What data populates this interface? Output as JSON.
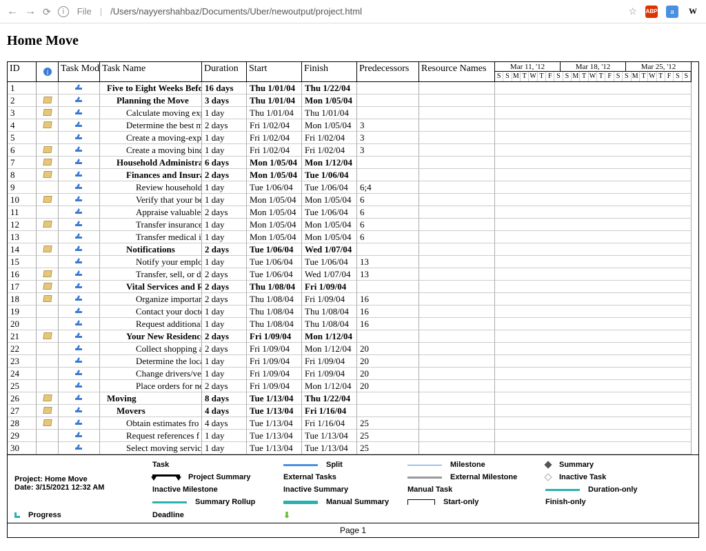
{
  "browser": {
    "url_prefix": "File",
    "url_path": "/Users/nayyershahbaz/Documents/Uber/newoutput/project.html"
  },
  "title": "Home Move",
  "columns": {
    "id": "ID",
    "info": "ℹ",
    "task_mode": "Task Mode",
    "task_name": "Task Name",
    "duration": "Duration",
    "start": "Start",
    "finish": "Finish",
    "predecessors": "Predecessors",
    "resource_names": "Resource Names"
  },
  "gantt": {
    "months": [
      "Mar 11, '12",
      "Mar 18, '12",
      "Mar 25, '12"
    ],
    "days": [
      "S",
      "S",
      "M",
      "T",
      "W",
      "T",
      "F",
      "S",
      "S",
      "M",
      "T",
      "W",
      "T",
      "F",
      "S",
      "S",
      "M",
      "T",
      "W",
      "T",
      "F",
      "S",
      "S"
    ]
  },
  "rows": [
    {
      "id": "1",
      "note": false,
      "indent": 0,
      "bold": true,
      "name": "Five to Eight Weeks Befo",
      "duration": "16 days",
      "start": "Thu 1/01/04",
      "finish": "Thu 1/22/04",
      "pred": "",
      "res": ""
    },
    {
      "id": "2",
      "note": true,
      "indent": 1,
      "bold": true,
      "name": "Planning the Move",
      "duration": "3 days",
      "start": "Thu 1/01/04",
      "finish": "Mon 1/05/04",
      "pred": "",
      "res": ""
    },
    {
      "id": "3",
      "note": true,
      "indent": 2,
      "bold": false,
      "name": "Calculate moving exp",
      "duration": "1 day",
      "start": "Thu 1/01/04",
      "finish": "Thu 1/01/04",
      "pred": "",
      "res": ""
    },
    {
      "id": "4",
      "note": true,
      "indent": 2,
      "bold": false,
      "name": "Determine the best m",
      "duration": "2 days",
      "start": "Fri 1/02/04",
      "finish": "Mon 1/05/04",
      "pred": "3",
      "res": ""
    },
    {
      "id": "5",
      "note": false,
      "indent": 2,
      "bold": false,
      "name": "Create a moving-expe",
      "duration": "1 day",
      "start": "Fri 1/02/04",
      "finish": "Fri 1/02/04",
      "pred": "3",
      "res": ""
    },
    {
      "id": "6",
      "note": true,
      "indent": 2,
      "bold": false,
      "name": "Create a moving bind",
      "duration": "1 day",
      "start": "Fri 1/02/04",
      "finish": "Fri 1/02/04",
      "pred": "3",
      "res": ""
    },
    {
      "id": "7",
      "note": true,
      "indent": 1,
      "bold": true,
      "name": "Household Administratio",
      "duration": "6 days",
      "start": "Mon 1/05/04",
      "finish": "Mon 1/12/04",
      "pred": "",
      "res": ""
    },
    {
      "id": "8",
      "note": true,
      "indent": 2,
      "bold": true,
      "name": "Finances and Insuran",
      "duration": "2 days",
      "start": "Mon 1/05/04",
      "finish": "Tue 1/06/04",
      "pred": "",
      "res": ""
    },
    {
      "id": "9",
      "note": false,
      "indent": 3,
      "bold": false,
      "name": "Review household fin",
      "duration": "1 day",
      "start": "Tue 1/06/04",
      "finish": "Tue 1/06/04",
      "pred": "6;4",
      "res": ""
    },
    {
      "id": "10",
      "note": true,
      "indent": 3,
      "bold": false,
      "name": "Verify that your belo",
      "duration": "1 day",
      "start": "Mon 1/05/04",
      "finish": "Mon 1/05/04",
      "pred": "6",
      "res": ""
    },
    {
      "id": "11",
      "note": false,
      "indent": 3,
      "bold": false,
      "name": "Appraise valuables s",
      "duration": "2 days",
      "start": "Mon 1/05/04",
      "finish": "Tue 1/06/04",
      "pred": "6",
      "res": ""
    },
    {
      "id": "12",
      "note": true,
      "indent": 3,
      "bold": false,
      "name": "Transfer insurance p",
      "duration": "1 day",
      "start": "Mon 1/05/04",
      "finish": "Mon 1/05/04",
      "pred": "6",
      "res": ""
    },
    {
      "id": "13",
      "note": false,
      "indent": 3,
      "bold": false,
      "name": "Transfer medical in",
      "duration": "1 day",
      "start": "Mon 1/05/04",
      "finish": "Mon 1/05/04",
      "pred": "6",
      "res": ""
    },
    {
      "id": "14",
      "note": true,
      "indent": 2,
      "bold": true,
      "name": "Notifications",
      "duration": "2 days",
      "start": "Tue 1/06/04",
      "finish": "Wed 1/07/04",
      "pred": "",
      "res": ""
    },
    {
      "id": "15",
      "note": false,
      "indent": 3,
      "bold": false,
      "name": "Notify your employ",
      "duration": "1 day",
      "start": "Tue 1/06/04",
      "finish": "Tue 1/06/04",
      "pred": "13",
      "res": ""
    },
    {
      "id": "16",
      "note": true,
      "indent": 3,
      "bold": false,
      "name": "Transfer, sell, or dis",
      "duration": "2 days",
      "start": "Tue 1/06/04",
      "finish": "Wed 1/07/04",
      "pred": "13",
      "res": ""
    },
    {
      "id": "17",
      "note": true,
      "indent": 2,
      "bold": true,
      "name": "Vital Services and Re",
      "duration": "2 days",
      "start": "Thu 1/08/04",
      "finish": "Fri 1/09/04",
      "pred": "",
      "res": ""
    },
    {
      "id": "18",
      "note": true,
      "indent": 3,
      "bold": false,
      "name": "Organize important r",
      "duration": "2 days",
      "start": "Thu 1/08/04",
      "finish": "Fri 1/09/04",
      "pred": "16",
      "res": ""
    },
    {
      "id": "19",
      "note": false,
      "indent": 3,
      "bold": false,
      "name": "Contact your docto",
      "duration": "1 day",
      "start": "Thu 1/08/04",
      "finish": "Thu 1/08/04",
      "pred": "16",
      "res": ""
    },
    {
      "id": "20",
      "note": false,
      "indent": 3,
      "bold": false,
      "name": "Request additional r",
      "duration": "1 day",
      "start": "Thu 1/08/04",
      "finish": "Thu 1/08/04",
      "pred": "16",
      "res": ""
    },
    {
      "id": "21",
      "note": true,
      "indent": 2,
      "bold": true,
      "name": "Your New Residence",
      "duration": "2 days",
      "start": "Fri 1/09/04",
      "finish": "Mon 1/12/04",
      "pred": "",
      "res": ""
    },
    {
      "id": "22",
      "note": false,
      "indent": 3,
      "bold": false,
      "name": "Collect shopping an",
      "duration": "2 days",
      "start": "Fri 1/09/04",
      "finish": "Mon 1/12/04",
      "pred": "20",
      "res": ""
    },
    {
      "id": "23",
      "note": false,
      "indent": 3,
      "bold": false,
      "name": "Determine the loca",
      "duration": "1 day",
      "start": "Fri 1/09/04",
      "finish": "Fri 1/09/04",
      "pred": "20",
      "res": ""
    },
    {
      "id": "24",
      "note": false,
      "indent": 3,
      "bold": false,
      "name": "Change drivers/veh",
      "duration": "1 day",
      "start": "Fri 1/09/04",
      "finish": "Fri 1/09/04",
      "pred": "20",
      "res": ""
    },
    {
      "id": "25",
      "note": false,
      "indent": 3,
      "bold": false,
      "name": "Place orders for new",
      "duration": "2 days",
      "start": "Fri 1/09/04",
      "finish": "Mon 1/12/04",
      "pred": "20",
      "res": ""
    },
    {
      "id": "26",
      "note": true,
      "indent": 0,
      "bold": true,
      "name": "Moving",
      "duration": "8 days",
      "start": "Tue 1/13/04",
      "finish": "Thu 1/22/04",
      "pred": "",
      "res": ""
    },
    {
      "id": "27",
      "note": true,
      "indent": 1,
      "bold": true,
      "name": "Movers",
      "duration": "4 days",
      "start": "Tue 1/13/04",
      "finish": "Fri 1/16/04",
      "pred": "",
      "res": ""
    },
    {
      "id": "28",
      "note": true,
      "indent": 2,
      "bold": false,
      "name": "Obtain estimates fro",
      "duration": "4 days",
      "start": "Tue 1/13/04",
      "finish": "Fri 1/16/04",
      "pred": "25",
      "res": ""
    },
    {
      "id": "29",
      "note": false,
      "indent": 2,
      "bold": false,
      "name": "Request references f",
      "duration": "1 day",
      "start": "Tue 1/13/04",
      "finish": "Tue 1/13/04",
      "pred": "25",
      "res": ""
    },
    {
      "id": "30",
      "note": false,
      "indent": 2,
      "bold": false,
      "name": "Select moving servic",
      "duration": "1 day",
      "start": "Tue 1/13/04",
      "finish": "Tue 1/13/04",
      "pred": "25",
      "res": ""
    }
  ],
  "legend": {
    "project_label": "Project: Home Move",
    "date_label": "Date: 3/15/2021 12:32 AM",
    "items": {
      "task": "Task",
      "external_tasks": "External Tasks",
      "manual_task": "Manual Task",
      "finish_only": "Finish-only",
      "split": "Split",
      "external_milestone": "External Milestone",
      "duration_only": "Duration-only",
      "progress": "Progress",
      "milestone": "Milestone",
      "inactive_task": "Inactive Task",
      "summary_rollup": "Summary Rollup",
      "deadline": "Deadline",
      "summary": "Summary",
      "inactive_milestone": "Inactive Milestone",
      "manual_summary": "Manual Summary",
      "start_only": "Start-only",
      "project_summary": "Project Summary",
      "inactive_summary": "Inactive Summary"
    }
  },
  "footer": "Page 1"
}
